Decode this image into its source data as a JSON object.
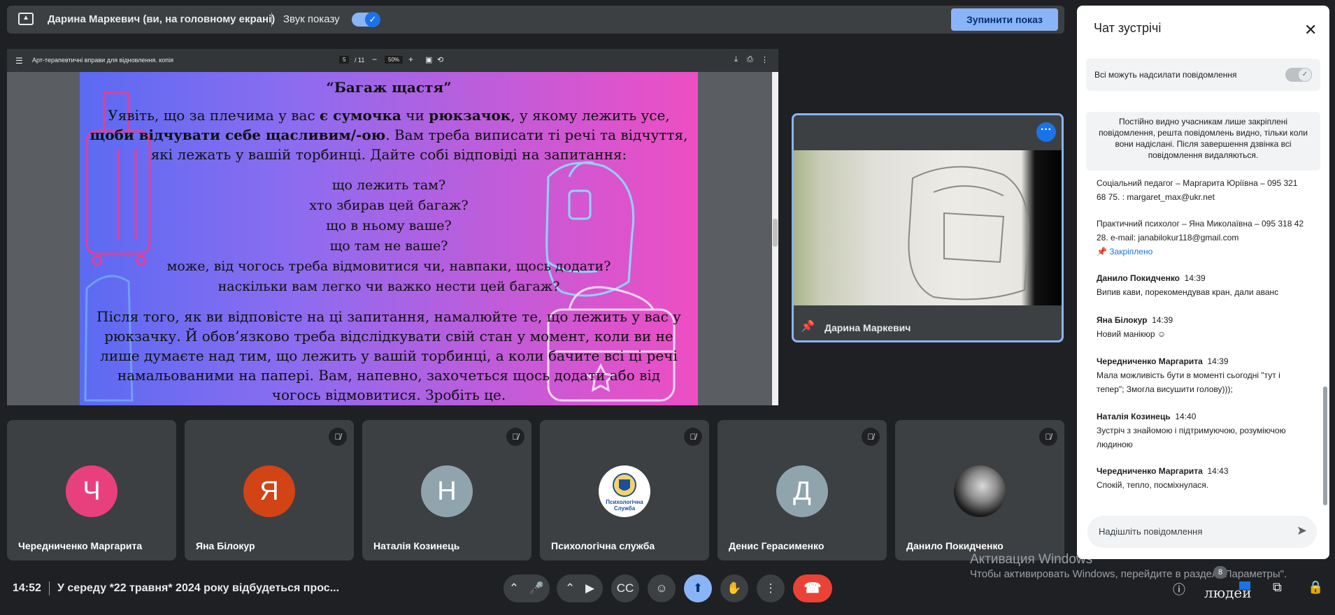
{
  "presentation_bar": {
    "title": "Дарина Маркевич (ви, на головному екрані)",
    "sound_label": "Звук показу",
    "stop_button": "Зупинити показ"
  },
  "shared_doc": {
    "doc_title": "Арт-терапевтичні вправи для відновлення. копія",
    "page": "5",
    "page_count": "/ 11",
    "zoom": "50%",
    "slide_title": "“Багаж щастя”",
    "paragraph1": {
      "l1_a": "Уявіть, що за плечима у вас ",
      "l1_b": "є сумочка",
      "l1_c": " чи ",
      "l1_d": "рюкзачок",
      "l1_e": ", у якому лежить усе,",
      "l2_a": "щоби відчувати себе щасливим/-ою",
      "l2_b": ". Вам треба виписати ті речі та відчуття,",
      "l3": "які лежать у вашій торбинці. Дайте собі відповіді на запитання:"
    },
    "questions": [
      "що лежить там?",
      "хто збирав цей багаж?",
      "що в ньому ваше?",
      "що там не ваше?",
      "може, від чогось треба відмовитися чи, навпаки, щось додати?",
      "наскільки вам легко чи важко нести цей багаж?"
    ],
    "paragraph2": [
      "Після того, як ви відповісте на ці запитання, намалюйте те, що лежить у вас у",
      "рюкзачку. Й обов’язково треба відслідкувати свій стан у момент, коли ви не",
      "лише думаєте над тим, що лежить у вашій торбинці, а коли бачите всі ці речі",
      "намальованими на папері. Вам, напевно, захочеться щось додати або від",
      "чогось відмовитися. Зробіть це."
    ]
  },
  "pinned_tile": {
    "name": "Дарина Маркевич"
  },
  "participants": [
    {
      "name": "Чередниченко Маргарита",
      "initial": "Ч",
      "color": "#e8407d",
      "muted": false
    },
    {
      "name": "Яна Білокур",
      "initial": "Я",
      "color": "#d24316",
      "muted": true
    },
    {
      "name": "Наталія Козинець",
      "initial": "Н",
      "color": "#90a4ae",
      "muted": true
    },
    {
      "name": "Психологічна служба",
      "initial": "",
      "logo_text": "Психологічна Служба",
      "color": "#ffffff",
      "muted": true
    },
    {
      "name": "Денис Герасименко",
      "initial": "Д",
      "color": "#90a4ae",
      "muted": true
    },
    {
      "name": "Данило Покидченко",
      "initial": "",
      "color": "#2a2a2a",
      "muted": true
    }
  ],
  "bottom_bar": {
    "time": "14:52",
    "meeting_title": "У середу *22 травня* 2024 року відбудеться прос...",
    "people_count": "8",
    "people_label": "людей",
    "watermark_title": "Активация Windows",
    "watermark_sub": "Чтобы активировать Windows, перейдите в раздел \"Параметры\"."
  },
  "chat": {
    "title": "Чат зустрічі",
    "setting_label": "Всі можуть надсилати повідомлення",
    "notice": "Постійно видно учасникам лише закріплені повідомлення, решта повідомлень видно, тільки коли вони надіслані. Після завершення дзвінка всі повідомлення видаляються.",
    "messages": [
      {
        "sender": "",
        "time": "",
        "text": "Соціальний педагог – Маргарита Юріївна – 095 321 68 75. : margaret_max@ukr.net"
      },
      {
        "sender": "",
        "time": "",
        "text": "Практичний психолог – Яна Миколаївна – 095 318 42 28. e-mail: janabilokur118@gmail.com",
        "pinned_label": "Закріплено"
      },
      {
        "sender": "Данило Покидченко",
        "time": "14:39",
        "text": "Випив кави, порекомендував кран, дали аванс"
      },
      {
        "sender": "Яна Білокур",
        "time": "14:39",
        "text": "Новий манікюр ☺"
      },
      {
        "sender": "Чередниченко Маргарита",
        "time": "14:39",
        "text": "Мала можливість бути в моменті сьогодні \"тут і тепер\"; Змогла висушити голову)));"
      },
      {
        "sender": "Наталія Козинець",
        "time": "14:40",
        "text": "Зустріч з знайомою і підтримуючою, розуміючою людиною"
      },
      {
        "sender": "Чередниченко Маргарита",
        "time": "14:43",
        "text": "Спокій, тепло, посміхнулася."
      }
    ],
    "input_placeholder": "Надішліть повідомлення"
  }
}
